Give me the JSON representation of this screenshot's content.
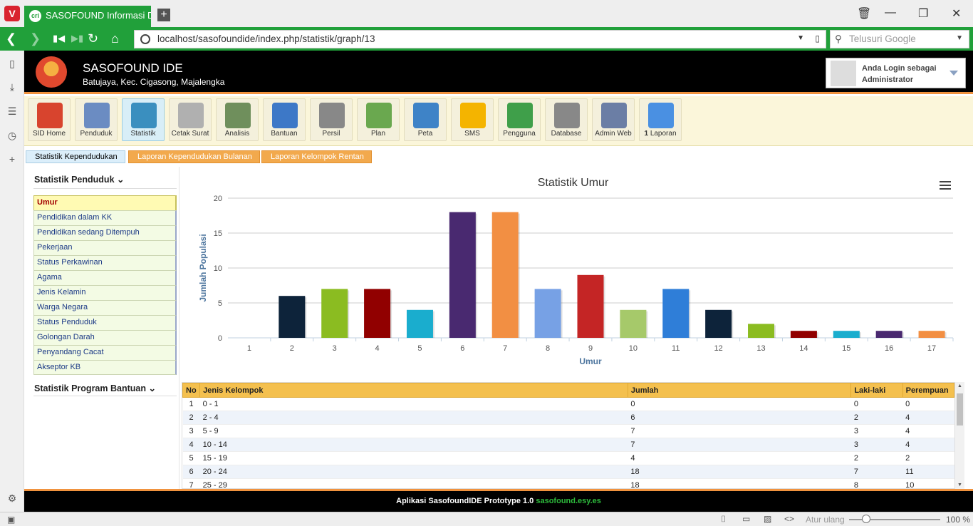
{
  "browser": {
    "tab_title": "SASOFOUND Informasi Desa",
    "url": "localhost/sasofoundide/index.php/statistik/graph/13",
    "search_placeholder": "Telusuri Google",
    "status_reset": "Atur ulang",
    "zoom": "100 %",
    "accent": "#21a03a"
  },
  "header": {
    "app_name": "SASOFOUND IDE",
    "location": "Batujaya, Kec. Cigasong, Majalengka",
    "login_line1": "Anda Login sebagai",
    "login_line2": "Administrator"
  },
  "toolbar": {
    "items": [
      {
        "label": "SID Home",
        "icon": "home-icon"
      },
      {
        "label": "Penduduk",
        "icon": "people-icon"
      },
      {
        "label": "Statistik",
        "icon": "chart-icon"
      },
      {
        "label": "Cetak Surat",
        "icon": "document-icon"
      },
      {
        "label": "Analisis",
        "icon": "binder-icon"
      },
      {
        "label": "Bantuan",
        "icon": "book-icon"
      },
      {
        "label": "Persil",
        "icon": "map-fold-icon"
      },
      {
        "label": "Plan",
        "icon": "plan-icon"
      },
      {
        "label": "Peta",
        "icon": "globe-icon"
      },
      {
        "label": "SMS",
        "icon": "sms-icon"
      },
      {
        "label": "Pengguna",
        "icon": "users-icon"
      },
      {
        "label": "Database",
        "icon": "database-icon"
      },
      {
        "label": "Admin Web",
        "icon": "admin-icon"
      },
      {
        "label": "Laporan",
        "icon": "mail-icon",
        "badge": "1"
      }
    ]
  },
  "subtabs": [
    "Statistik Kependudukan",
    "Laporan Kependudukan Bulanan",
    "Laporan Kelompok Rentan"
  ],
  "sidebar": {
    "section1": "Statistik Penduduk",
    "section2": "Statistik Program Bantuan",
    "items": [
      "Umur",
      "Pendidikan dalam KK",
      "Pendidikan sedang Ditempuh",
      "Pekerjaan",
      "Status Perkawinan",
      "Agama",
      "Jenis Kelamin",
      "Warga Negara",
      "Status Penduduk",
      "Golongan Darah",
      "Penyandang Cacat",
      "Akseptor KB"
    ]
  },
  "chart_data": {
    "type": "bar",
    "title": "Statistik Umur",
    "xlabel": "Umur",
    "ylabel": "Jumlah Populasi",
    "categories": [
      "1",
      "2",
      "3",
      "4",
      "5",
      "6",
      "7",
      "8",
      "9",
      "10",
      "11",
      "12",
      "13",
      "14",
      "15",
      "16",
      "17"
    ],
    "values": [
      0,
      6,
      7,
      7,
      4,
      18,
      18,
      7,
      9,
      4,
      7,
      4,
      2,
      1,
      1,
      1,
      1
    ],
    "colors": [
      "#2f7ed8",
      "#0d233a",
      "#8bbc21",
      "#910000",
      "#1aadce",
      "#492970",
      "#f28f43",
      "#77a1e5",
      "#c42525",
      "#a6c96a",
      "#2f7ed8",
      "#0d233a",
      "#8bbc21",
      "#910000",
      "#1aadce",
      "#492970",
      "#f28f43"
    ],
    "yticks": [
      0,
      5,
      10,
      15,
      20
    ],
    "ylim": [
      0,
      20
    ],
    "grid": true
  },
  "table": {
    "headers": [
      "No",
      "Jenis Kelompok",
      "Jumlah",
      "Laki-laki",
      "Perempuan"
    ],
    "rows": [
      [
        "1",
        "0 - 1",
        "0",
        "0",
        "0"
      ],
      [
        "2",
        "2 - 4",
        "6",
        "2",
        "4"
      ],
      [
        "3",
        "5 - 9",
        "7",
        "3",
        "4"
      ],
      [
        "4",
        "10 - 14",
        "7",
        "3",
        "4"
      ],
      [
        "5",
        "15 - 19",
        "4",
        "2",
        "2"
      ],
      [
        "6",
        "20 - 24",
        "18",
        "7",
        "11"
      ],
      [
        "7",
        "25 - 29",
        "18",
        "8",
        "10"
      ]
    ]
  },
  "footer": {
    "text": "Aplikasi SasofoundIDE Prototype 1.0",
    "link": "sasofound.esy.es"
  }
}
